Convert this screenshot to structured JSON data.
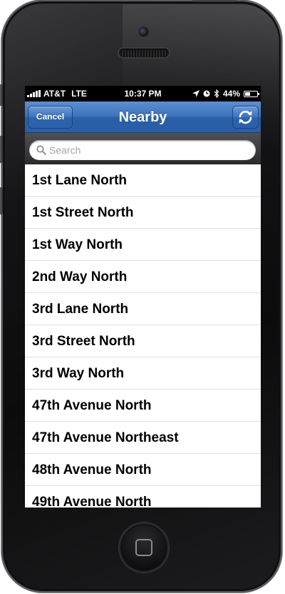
{
  "status_bar": {
    "carrier": "AT&T",
    "network": "LTE",
    "time": "10:37 PM",
    "battery": "44%",
    "battery_level": 0.44,
    "icons": [
      "signal-icon",
      "location-arrow-icon",
      "alarm-icon",
      "bluetooth-icon",
      "battery-icon"
    ]
  },
  "nav": {
    "title": "Nearby",
    "cancel_label": "Cancel",
    "refresh_icon": "refresh-icon"
  },
  "search": {
    "placeholder": "Search",
    "value": ""
  },
  "list": {
    "items": [
      "1st Lane North",
      "1st Street North",
      "1st Way North",
      "2nd Way North",
      "3rd Lane North",
      "3rd Street North",
      "3rd Way North",
      "47th Avenue North",
      "47th Avenue Northeast",
      "48th Avenue North",
      "49th Avenue North"
    ]
  },
  "colors": {
    "nav_blue": "#3a72ba",
    "button_blue": "#3a72bd",
    "phone_black": "#0b0b0c"
  }
}
